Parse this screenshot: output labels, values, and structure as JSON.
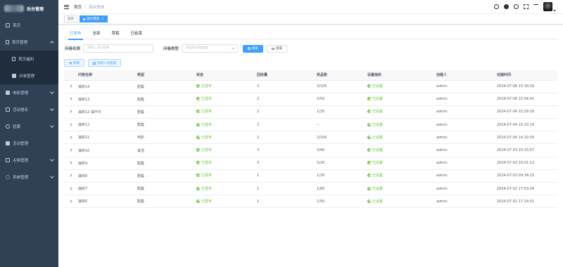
{
  "app": {
    "title": "后台管理"
  },
  "sidebar": {
    "items": [
      {
        "label": "首页",
        "icon": "home-icon"
      },
      {
        "label": "首页管理",
        "icon": "document-icon",
        "expanded": true,
        "children": [
          {
            "label": "首页福利"
          },
          {
            "label": "问卷管理"
          }
        ]
      },
      {
        "label": "电影管理",
        "icon": "film-icon"
      },
      {
        "label": "活动报名",
        "icon": "calendar-icon"
      },
      {
        "label": "招募",
        "icon": "user-icon"
      },
      {
        "label": "活动管理",
        "icon": "activity-icon"
      },
      {
        "label": "点映管理",
        "icon": "screen-icon"
      },
      {
        "label": "系统管理",
        "icon": "gear-icon"
      }
    ]
  },
  "header": {
    "breadcrumb": [
      "首页",
      "观众预测"
    ],
    "icons": [
      "search-icon",
      "github-icon",
      "help-icon",
      "fullscreen-icon",
      "font-size-icon"
    ]
  },
  "tags": [
    {
      "label": "首页",
      "active": false
    },
    {
      "label": "观众预测",
      "active": true
    }
  ],
  "tabs": [
    {
      "label": "已发布",
      "active": true
    },
    {
      "label": "全部",
      "active": false
    },
    {
      "label": "草稿",
      "active": false
    },
    {
      "label": "已结束",
      "active": false
    }
  ],
  "filters": {
    "name_label": "问卷名称",
    "name_placeholder": "请输入活动名称",
    "type_label": "问卷类型",
    "type_placeholder": "请选择问卷类型",
    "search_label": "搜索",
    "reset_label": "重置"
  },
  "actions": {
    "add_label": "新增",
    "manage_label": "抢购人员管理"
  },
  "table": {
    "columns": [
      "问卷名称",
      "类型",
      "状态",
      "回收量",
      "奖品数",
      "设置抽奖",
      "创建人",
      "创建时间"
    ],
    "rows": [
      {
        "name": "抽奖14",
        "type": "剧集",
        "status": "已发布",
        "count": "3",
        "prize": "3/100",
        "setting": "已设置",
        "creator": "admin",
        "time": "2024-07-08 15:18:29"
      },
      {
        "name": "抽奖13",
        "type": "剧集",
        "status": "已发布",
        "count": "2",
        "prize": "2/50",
        "setting": "已设置",
        "creator": "admin",
        "time": "2024-07-08 15:06:42"
      },
      {
        "name": "抽奖12 抽不中",
        "type": "剧集",
        "status": "已发布",
        "count": "2",
        "prize": "1/30",
        "setting": "已设置",
        "creator": "admin",
        "time": "2024-07-04 15:29:18"
      },
      {
        "name": "抽奖12",
        "type": "剧集",
        "status": "已发布",
        "count": "2",
        "prize": "--",
        "setting": "已设置",
        "creator": "admin",
        "time": "2024-07-04 15:15:19"
      },
      {
        "name": "抽奖11",
        "type": "电影",
        "status": "已发布",
        "count": "2",
        "prize": "2/100",
        "setting": "已设置",
        "creator": "admin",
        "time": "2024-07-04 14:32:59"
      },
      {
        "name": "抽奖10",
        "type": "其他",
        "status": "已发布",
        "count": "3",
        "prize": "3/40",
        "setting": "已设置",
        "creator": "admin",
        "time": "2024-07-03 10:15:57"
      },
      {
        "name": "抽奖9",
        "type": "剧集",
        "status": "已发布",
        "count": "3",
        "prize": "3/20",
        "setting": "已设置",
        "creator": "admin",
        "time": "2024-07-03 10:01:12"
      },
      {
        "name": "抽奖8",
        "type": "剧集",
        "status": "已发布",
        "count": "1",
        "prize": "1/30",
        "setting": "已设置",
        "creator": "admin",
        "time": "2024-07-03 09:34:23"
      },
      {
        "name": "抽奖7",
        "type": "剧集",
        "status": "已发布",
        "count": "1",
        "prize": "1/60",
        "setting": "已设置",
        "creator": "admin",
        "time": "2024-07-02 17:53:34"
      },
      {
        "name": "抽奖6",
        "type": "剧集",
        "status": "已发布",
        "count": "1",
        "prize": "1/50",
        "setting": "已设置",
        "creator": "admin",
        "time": "2024-07-02 17:14:51"
      }
    ]
  },
  "colors": {
    "sidebar_bg": "#304156",
    "submenu_bg": "#1f2d3d",
    "primary": "#409eff",
    "success": "#67c23a"
  }
}
